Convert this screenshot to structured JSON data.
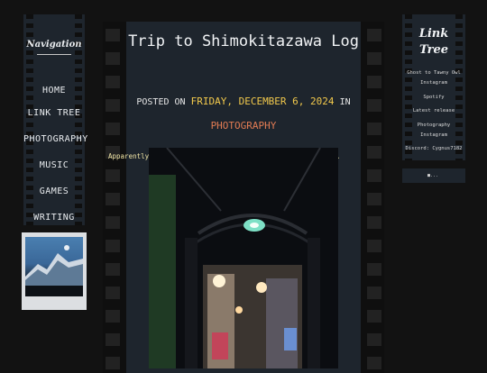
{
  "nav": {
    "title": "Navigation",
    "items": [
      "HOME",
      "LINK TREE",
      "PHOTOGRAPHY",
      "MUSIC",
      "GAMES",
      "WRITING"
    ]
  },
  "post": {
    "title": "Trip to Shimokitazawa Log",
    "posted_on": "POSTED ON",
    "date": "FRIDAY, DECEMBER 6, 2024",
    "in": "IN",
    "category": "PHOTOGRAPHY",
    "body": "Apparently this is the kakkoii, hip district. And it was."
  },
  "linktree": {
    "title_line1": "Link",
    "title_line2": "Tree",
    "items": [
      "Ghost to Tawny Owl",
      "Instagram",
      "Spotify",
      "Latest release",
      "Photography",
      "Instagram",
      "Discord: Cygnus7182"
    ]
  },
  "badge": {
    "alt": "■..."
  },
  "colors": {
    "background": "#121212",
    "panel": "#1e252d",
    "date": "#f2c94c",
    "category": "#e07b53"
  }
}
